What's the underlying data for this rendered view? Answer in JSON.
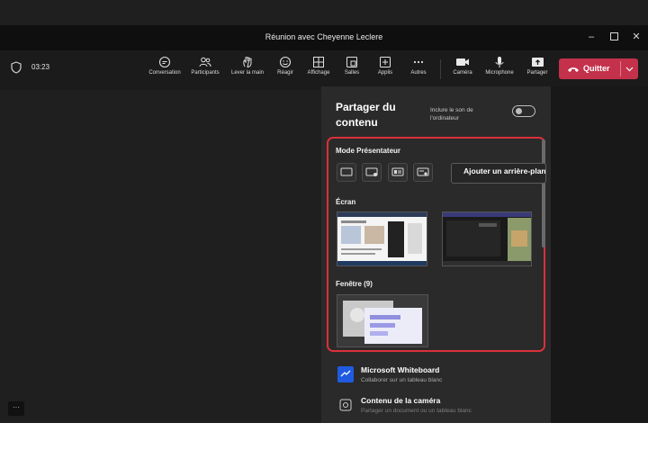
{
  "window": {
    "title": "Réunion avec Cheyenne Leclere"
  },
  "toolbar": {
    "timer": "03:23",
    "items": [
      {
        "label": "Conversation",
        "icon": "chat-icon"
      },
      {
        "label": "Participants",
        "icon": "people-icon"
      },
      {
        "label": "Lever la main",
        "icon": "hand-icon"
      },
      {
        "label": "Réagir",
        "icon": "smiley-icon"
      },
      {
        "label": "Affichage",
        "icon": "grid-icon"
      },
      {
        "label": "Salles",
        "icon": "rooms-icon"
      },
      {
        "label": "Applis",
        "icon": "apps-icon"
      },
      {
        "label": "Autres",
        "icon": "more-icon"
      },
      {
        "label": "Caméra",
        "icon": "camera-icon"
      },
      {
        "label": "Microphone",
        "icon": "mic-icon"
      },
      {
        "label": "Partager",
        "icon": "share-icon"
      }
    ],
    "quit_label": "Quitter",
    "more_button": "···"
  },
  "share_panel": {
    "title": "Partager du contenu",
    "include_sound_label": "Inclure le son de l'ordinateur",
    "presenter_mode_label": "Mode Présentateur",
    "background_button": "Ajouter un arrière-plan",
    "screen_label": "Écran",
    "window_label": "Fenêtre (9)",
    "apps": [
      {
        "title": "Microsoft Whiteboard",
        "subtitle": "Collaborer sur un tableau blanc"
      },
      {
        "title": "Contenu de la caméra",
        "subtitle": "Partager un document ou un tableau blanc"
      }
    ]
  },
  "colors": {
    "accent": "#7f85f5",
    "quit": "#c4314b",
    "highlight": "#d9303a",
    "whiteboard": "#1e5be0"
  }
}
